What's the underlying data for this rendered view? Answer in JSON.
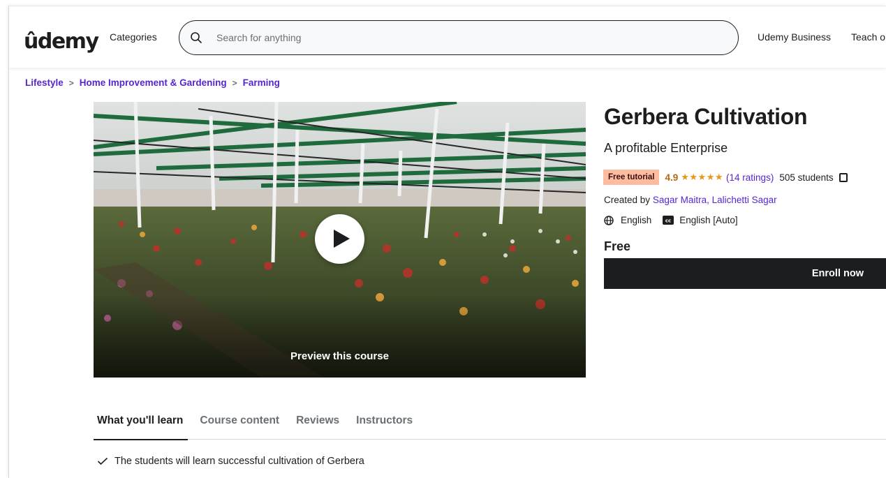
{
  "header": {
    "logo_text": "ûdemy",
    "categories_label": "Categories",
    "search_placeholder": "Search for anything",
    "udemy_business_label": "Udemy Business",
    "teach_label": "Teach o"
  },
  "breadcrumb": [
    "Lifestyle",
    "Home Improvement & Gardening",
    "Farming"
  ],
  "preview": {
    "label": "Preview this course"
  },
  "course": {
    "title": "Gerbera Cultivation",
    "subtitle": "A profitable Enterprise",
    "badge": "Free tutorial",
    "rating": "4.9",
    "stars": "★★★★★",
    "ratings_count": "(14 ratings)",
    "students": "505 students",
    "created_by_label": "Created by",
    "instructors": "Sagar Maitra, Lalichetti Sagar",
    "language": "English",
    "captions": "English [Auto]",
    "price": "Free",
    "enroll_label": "Enroll now"
  },
  "tabs": [
    "What you'll learn",
    "Course content",
    "Reviews",
    "Instructors"
  ],
  "learn_items": [
    "The students will learn successful cultivation of Gerbera"
  ],
  "colors": {
    "brand_purple": "#a435f0",
    "link_purple": "#5624d0",
    "badge_bg": "#fcbca0",
    "rating_orange": "#b4690e",
    "button_dark": "#1c1d1f"
  }
}
